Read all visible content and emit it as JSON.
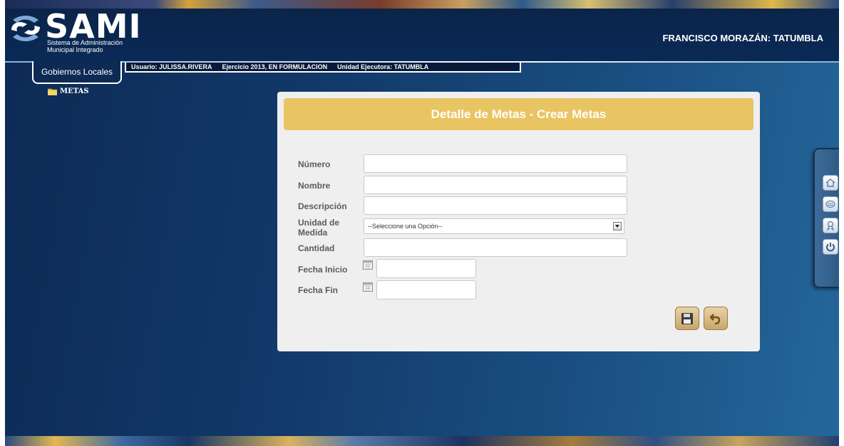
{
  "header": {
    "logo_text": "SAMI",
    "logo_sub_line1": "Sistema de Administración",
    "logo_sub_line2": "Municipal Integrado",
    "municipality": "FRANCISCO MORAZÁN: TATUMBLA"
  },
  "nav": {
    "tab_label": "Gobiernos Locales",
    "usuario": "Usuario: JULISSA.RIVERA",
    "ejercicio": "Ejercicio 2013, EN FORMULACION",
    "unidad": "Unidad Ejecutora: TATUMBLA"
  },
  "sidebar": {
    "items": [
      {
        "label": "METAS",
        "icon": "folder-icon"
      }
    ]
  },
  "form": {
    "title": "Detalle de Metas - Crear Metas",
    "numero_label": "Número",
    "numero_value": "",
    "nombre_label": "Nombre",
    "nombre_value": "",
    "descripcion_label": "Descripción",
    "descripcion_value": "",
    "unidad_label_line1": "Unidad de",
    "unidad_label_line2": "Medida",
    "unidad_selected": "--Seleccione una Opción--",
    "cantidad_label": "Cantidad",
    "cantidad_value": "",
    "fecha_inicio_label": "Fecha Inicio",
    "fecha_fin_label": "Fecha Fin",
    "save_icon": "save-icon",
    "back_icon": "undo-icon"
  },
  "dock": {
    "icons": [
      "home-icon",
      "keyboard-icon",
      "ribbon-icon",
      "power-icon"
    ]
  },
  "colors": {
    "panel_title_bg": "#e9c462",
    "background": "#113868",
    "panel_bg": "#efefef"
  }
}
